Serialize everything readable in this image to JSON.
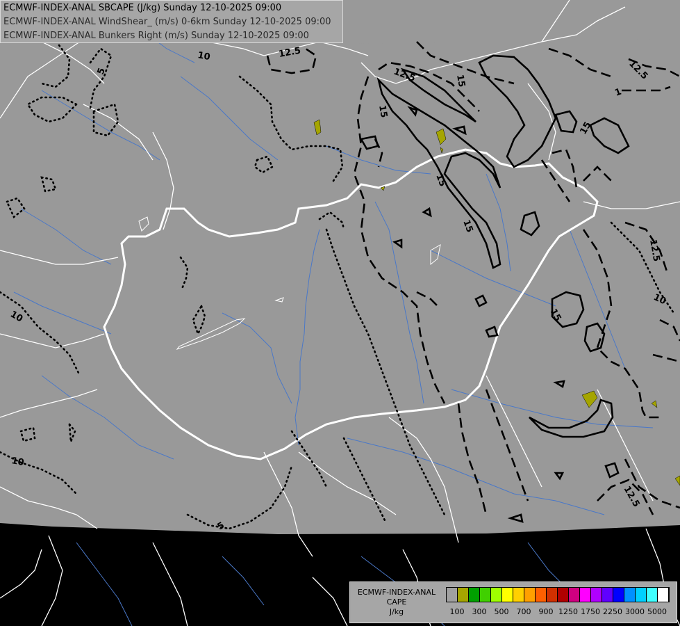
{
  "title_lines": [
    "ECMWF-INDEX-ANAL SBCAPE (J/kg) Sunday 12-10-2025 09:00",
    "ECMWF-INDEX-ANAL WindShear_ (m/s) 0-6km Sunday 12-10-2025 09:00",
    "ECMWF-INDEX-ANAL Bunkers Right (m/s) Sunday 12-10-2025 09:00"
  ],
  "legend": {
    "line1": "ECMWF-INDEX-ANAL",
    "line2": "CAPE",
    "line3": "J/kg",
    "colors": [
      "#a0a0a0",
      "#a5a500",
      "#00a000",
      "#40d000",
      "#a0ff00",
      "#ffff00",
      "#ffd000",
      "#ffa000",
      "#ff6000",
      "#d03000",
      "#b00000",
      "#d00080",
      "#ff00ff",
      "#b000ff",
      "#6000ff",
      "#0000ff",
      "#0090ff",
      "#00d0ff",
      "#40ffff",
      "#ffffff"
    ],
    "ticks": [
      "100",
      "300",
      "500",
      "700",
      "900",
      "1250",
      "1750",
      "2250",
      "3000",
      "5000"
    ]
  },
  "contour_labels": {
    "dotted": [
      "5",
      "10",
      "10",
      "10",
      "5"
    ],
    "dashed": [
      "12.5",
      "12.5",
      "12.5",
      "12.5",
      "12.5",
      "10",
      "1"
    ],
    "solid": [
      "15",
      "15",
      "15",
      "15",
      "15",
      "15"
    ]
  },
  "colors": {
    "map_background": "#999999",
    "outside": "#000000",
    "borders": "#ffffff",
    "rivers": "#4a78c8",
    "contours": "#000000",
    "cape_fill": "#a5a500"
  }
}
